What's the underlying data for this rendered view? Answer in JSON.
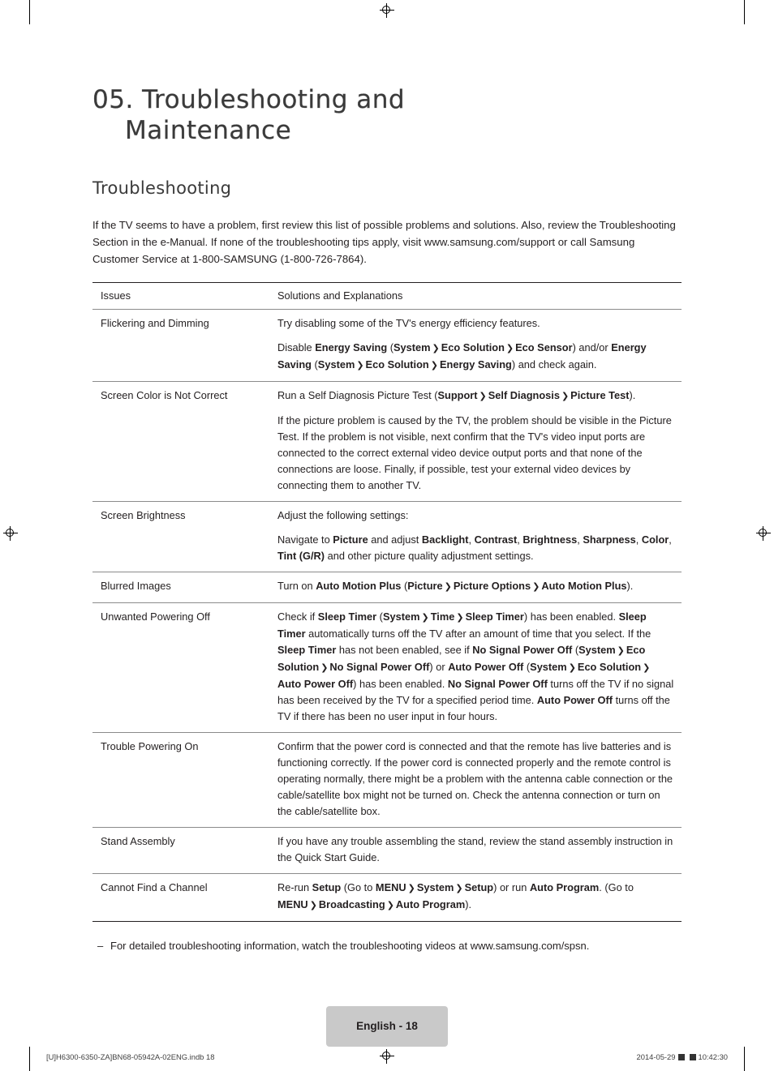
{
  "document": {
    "chapter_title_line1": "05. Troubleshooting and",
    "chapter_title_line2": "Maintenance",
    "section_title": "Troubleshooting",
    "intro": "If the TV seems to have a problem, first review this list of possible problems and solutions. Also, review the Troubleshooting Section in the e-Manual. If none of the troubleshooting tips apply, visit www.samsung.com/support or call Samsung Customer Service at 1-800-SAMSUNG (1-800-726-7864).",
    "footnote": "For detailed troubleshooting information, watch the troubleshooting videos at www.samsung.com/spsn.",
    "footnote_dash": "–"
  },
  "table": {
    "headers": {
      "issues": "Issues",
      "solutions": "Solutions and Explanations"
    },
    "rows": [
      {
        "issue": "Flickering and Dimming",
        "paragraphs": [
          {
            "parts": [
              {
                "t": "Try disabling some of the TV's energy efficiency features.",
                "b": false
              }
            ]
          },
          {
            "parts": [
              {
                "t": "Disable ",
                "b": false
              },
              {
                "t": "Energy Saving",
                "b": true
              },
              {
                "t": " (",
                "b": false
              },
              {
                "t": "System",
                "b": true
              },
              {
                "t": "ARROW",
                "b": false
              },
              {
                "t": "Eco Solution",
                "b": true
              },
              {
                "t": "ARROW",
                "b": false
              },
              {
                "t": "Eco Sensor",
                "b": true
              },
              {
                "t": ") and/or ",
                "b": false
              },
              {
                "t": "Energy Saving",
                "b": true
              },
              {
                "t": " (",
                "b": false
              },
              {
                "t": "System",
                "b": true
              },
              {
                "t": "ARROW",
                "b": false
              },
              {
                "t": "Eco Solution",
                "b": true
              },
              {
                "t": "ARROW",
                "b": false
              },
              {
                "t": "Energy Saving",
                "b": true
              },
              {
                "t": ") and check again.",
                "b": false
              }
            ]
          }
        ]
      },
      {
        "issue": "Screen Color is Not Correct",
        "paragraphs": [
          {
            "parts": [
              {
                "t": "Run a Self Diagnosis Picture Test (",
                "b": false
              },
              {
                "t": "Support",
                "b": true
              },
              {
                "t": "ARROW",
                "b": false
              },
              {
                "t": "Self Diagnosis",
                "b": true
              },
              {
                "t": "ARROW",
                "b": false
              },
              {
                "t": "Picture Test",
                "b": true
              },
              {
                "t": ").",
                "b": false
              }
            ]
          },
          {
            "parts": [
              {
                "t": "If the picture problem is caused by the TV, the problem should be visible in the Picture Test. If the problem is not visible, next confirm that the TV's video input ports are connected to the correct external video device output ports and that none of the connections are loose. Finally, if possible, test your external video devices by connecting them to another TV.",
                "b": false
              }
            ]
          }
        ]
      },
      {
        "issue": "Screen Brightness",
        "paragraphs": [
          {
            "parts": [
              {
                "t": "Adjust the following settings:",
                "b": false
              }
            ]
          },
          {
            "parts": [
              {
                "t": "Navigate to ",
                "b": false
              },
              {
                "t": "Picture",
                "b": true
              },
              {
                "t": " and adjust ",
                "b": false
              },
              {
                "t": "Backlight",
                "b": true
              },
              {
                "t": ", ",
                "b": false
              },
              {
                "t": "Contrast",
                "b": true
              },
              {
                "t": ", ",
                "b": false
              },
              {
                "t": "Brightness",
                "b": true
              },
              {
                "t": ", ",
                "b": false
              },
              {
                "t": "Sharpness",
                "b": true
              },
              {
                "t": ", ",
                "b": false
              },
              {
                "t": "Color",
                "b": true
              },
              {
                "t": ", ",
                "b": false
              },
              {
                "t": "Tint (G/R)",
                "b": true
              },
              {
                "t": " and other picture quality adjustment settings.",
                "b": false
              }
            ]
          }
        ]
      },
      {
        "issue": "Blurred Images",
        "paragraphs": [
          {
            "parts": [
              {
                "t": "Turn on ",
                "b": false
              },
              {
                "t": "Auto Motion Plus",
                "b": true
              },
              {
                "t": " (",
                "b": false
              },
              {
                "t": "Picture",
                "b": true
              },
              {
                "t": "ARROW",
                "b": false
              },
              {
                "t": "Picture Options",
                "b": true
              },
              {
                "t": "ARROW",
                "b": false
              },
              {
                "t": "Auto Motion Plus",
                "b": true
              },
              {
                "t": ").",
                "b": false
              }
            ]
          }
        ]
      },
      {
        "issue": "Unwanted Powering Off",
        "paragraphs": [
          {
            "parts": [
              {
                "t": "Check if ",
                "b": false
              },
              {
                "t": "Sleep Timer",
                "b": true
              },
              {
                "t": " (",
                "b": false
              },
              {
                "t": "System",
                "b": true
              },
              {
                "t": "ARROW",
                "b": false
              },
              {
                "t": "Time",
                "b": true
              },
              {
                "t": "ARROW",
                "b": false
              },
              {
                "t": "Sleep Timer",
                "b": true
              },
              {
                "t": ") has been enabled. ",
                "b": false
              },
              {
                "t": "Sleep Timer",
                "b": true
              },
              {
                "t": " automatically turns off the TV after an amount of time that you select. If the ",
                "b": false
              },
              {
                "t": "Sleep Timer",
                "b": true
              },
              {
                "t": " has not been enabled, see if ",
                "b": false
              },
              {
                "t": "No Signal Power Off",
                "b": true
              },
              {
                "t": " (",
                "b": false
              },
              {
                "t": "System",
                "b": true
              },
              {
                "t": "ARROW",
                "b": false
              },
              {
                "t": "Eco Solution",
                "b": true
              },
              {
                "t": "ARROW",
                "b": false
              },
              {
                "t": "No Signal Power Off",
                "b": true
              },
              {
                "t": ") or ",
                "b": false
              },
              {
                "t": "Auto Power Off",
                "b": true
              },
              {
                "t": " (",
                "b": false
              },
              {
                "t": "System",
                "b": true
              },
              {
                "t": "ARROW",
                "b": false
              },
              {
                "t": "Eco Solution",
                "b": true
              },
              {
                "t": "ARROW",
                "b": false
              },
              {
                "t": "Auto Power Off",
                "b": true
              },
              {
                "t": ") has been enabled. ",
                "b": false
              },
              {
                "t": "No Signal Power Off",
                "b": true
              },
              {
                "t": " turns off the TV if no signal has been received by the TV for a specified period time. ",
                "b": false
              },
              {
                "t": "Auto Power Off",
                "b": true
              },
              {
                "t": " turns off the TV if there has been no user input in four hours.",
                "b": false
              }
            ]
          }
        ]
      },
      {
        "issue": "Trouble Powering On",
        "paragraphs": [
          {
            "parts": [
              {
                "t": "Confirm that the power cord is connected and that the remote has live batteries and is functioning correctly. If the power cord is connected properly and the remote control is operating normally, there might be a problem with the antenna cable connection or the cable/satellite box might not be turned on. Check the antenna connection or turn on the cable/satellite box.",
                "b": false
              }
            ]
          }
        ]
      },
      {
        "issue": "Stand Assembly",
        "paragraphs": [
          {
            "parts": [
              {
                "t": "If you have any trouble assembling the stand, review the stand assembly instruction in the Quick Start Guide.",
                "b": false
              }
            ]
          }
        ]
      },
      {
        "issue": "Cannot Find a Channel",
        "paragraphs": [
          {
            "parts": [
              {
                "t": "Re-run ",
                "b": false
              },
              {
                "t": "Setup",
                "b": true
              },
              {
                "t": " (Go to ",
                "b": false
              },
              {
                "t": "MENU",
                "b": true
              },
              {
                "t": "ARROW",
                "b": false
              },
              {
                "t": "System",
                "b": true
              },
              {
                "t": "ARROW",
                "b": false
              },
              {
                "t": "Setup",
                "b": true
              },
              {
                "t": ") or run ",
                "b": false
              },
              {
                "t": "Auto Program",
                "b": true
              },
              {
                "t": ". (Go to ",
                "b": false
              },
              {
                "t": "MENU",
                "b": true
              },
              {
                "t": "ARROW",
                "b": false
              },
              {
                "t": "Broadcasting",
                "b": true
              },
              {
                "t": "ARROW",
                "b": false
              },
              {
                "t": "Auto Program",
                "b": true
              },
              {
                "t": ").",
                "b": false
              }
            ]
          }
        ]
      }
    ]
  },
  "footer": {
    "page_label": "English - 18",
    "left_text": "[U]H6300-6350-ZA]BN68-05942A-02ENG.indb   18",
    "right_text_date": "2014-05-29",
    "right_text_time": "10:42:30"
  }
}
